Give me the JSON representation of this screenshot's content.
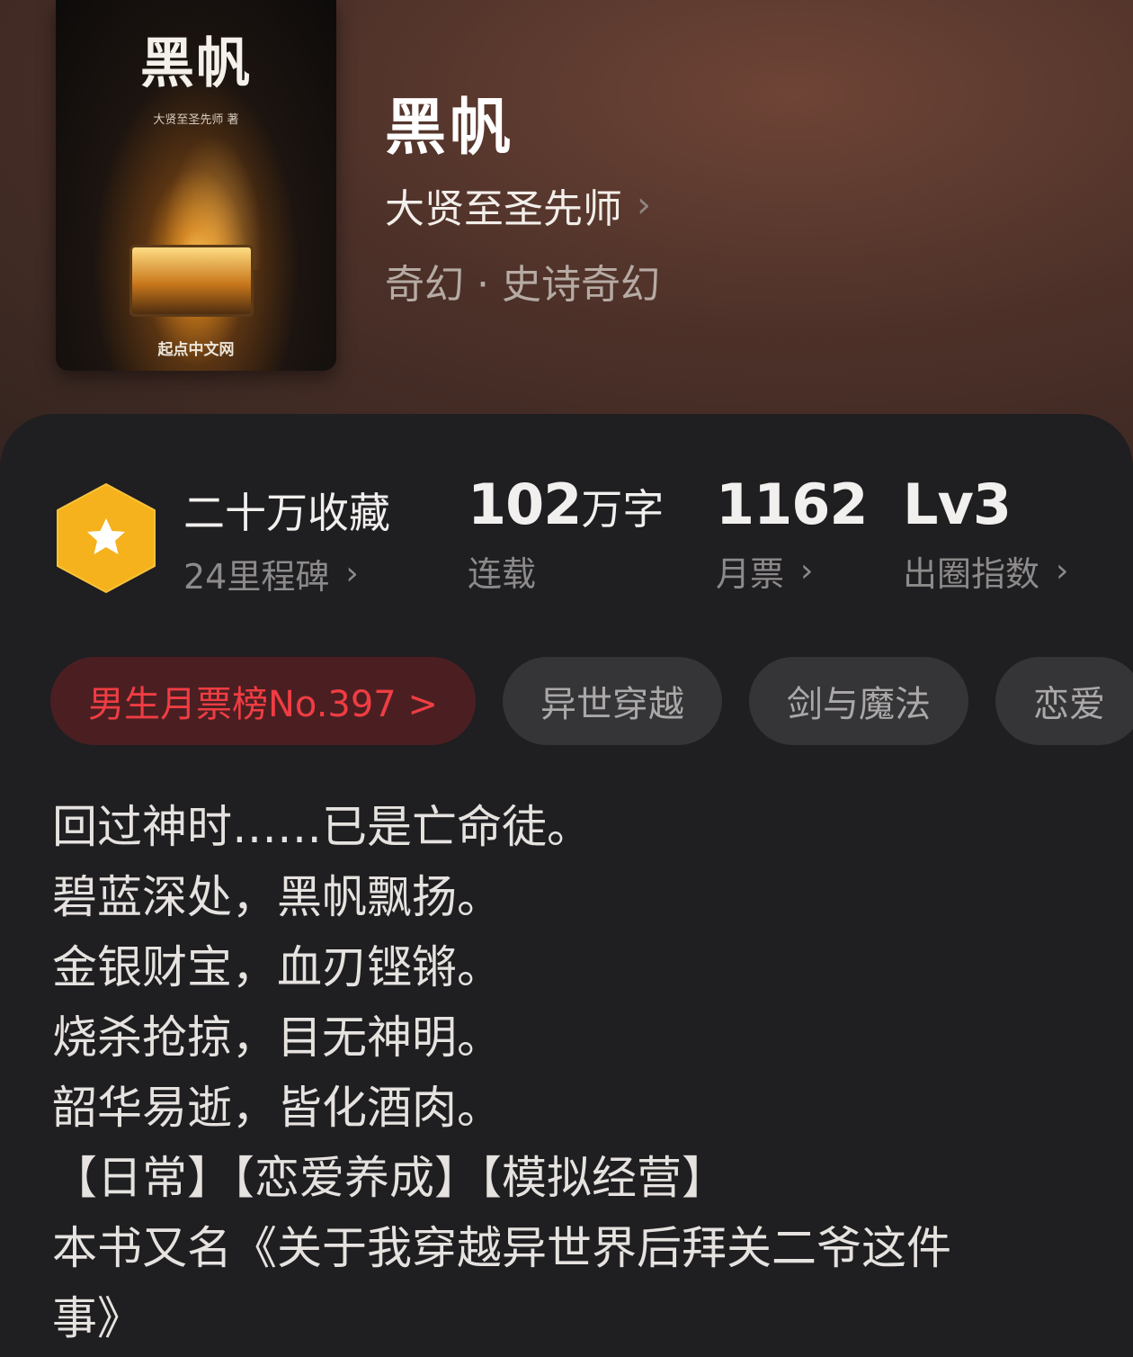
{
  "cover": {
    "title": "黑帆",
    "author_line": "大贤至圣先师 著",
    "publisher": "起点中文网"
  },
  "book": {
    "title": "黑帆",
    "author": "大贤至圣先师",
    "genre": "奇幻 · 史诗奇幻"
  },
  "stats": {
    "collection": {
      "value": "二十万收藏",
      "sub": "24里程碑"
    },
    "words": {
      "number": "102",
      "unit": "万字",
      "sub": "连载"
    },
    "tickets": {
      "value": "1162",
      "sub": "月票"
    },
    "level": {
      "value": "Lv3",
      "sub": "出圈指数"
    }
  },
  "tags": [
    {
      "label": "男生月票榜No.397 >"
    },
    {
      "label": "异世穿越"
    },
    {
      "label": "剑与魔法"
    },
    {
      "label": "恋爱"
    }
  ],
  "synopsis": [
    "回过神时……已是亡命徒。",
    "碧蓝深处，黑帆飘扬。",
    "金银财宝，血刃铿锵。",
    "烧杀抢掠，目无神明。",
    "韶华易逝，皆化酒肉。",
    "【日常】【恋爱养成】【模拟经营】",
    "本书又名《关于我穿越异世界后拜关二爷这件",
    "事》"
  ],
  "colors": {
    "accent_red": "#ef3d43",
    "badge_gold": "#f5b21c",
    "panel": "#1f1e20"
  },
  "icons": {
    "badge": "star-badge-icon",
    "arrow": "chevron-right-icon"
  }
}
